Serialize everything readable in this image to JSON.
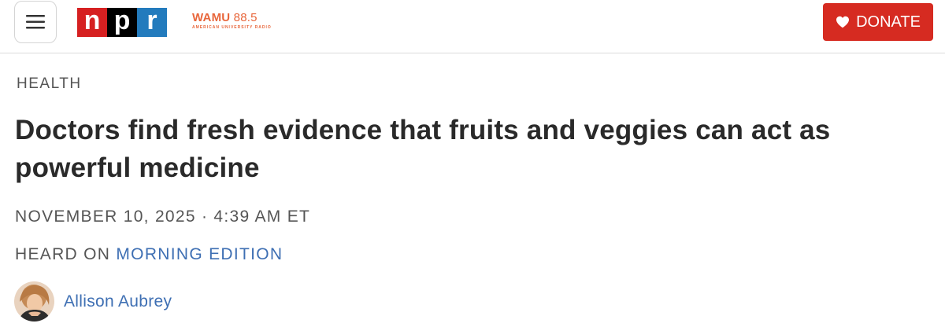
{
  "header": {
    "menu_icon": "hamburger-menu-icon",
    "logo": {
      "letters": [
        "n",
        "p",
        "r"
      ],
      "colors": [
        "#d62021",
        "#000000",
        "#237bbd"
      ]
    },
    "station": {
      "name": "WAMU",
      "frequency": "88.5",
      "tagline": "AMERICAN UNIVERSITY RADIO",
      "color": "#e8663b"
    },
    "donate": {
      "label": "DONATE",
      "icon": "heart-icon",
      "color": "#d62b21"
    }
  },
  "article": {
    "section": "HEALTH",
    "headline": "Doctors find fresh evidence that fruits and veggies can act as powerful medicine",
    "dateline": "NOVEMBER 10, 2025 · 4:39 AM ET",
    "heard_on_prefix": "HEARD ON",
    "heard_on_show": "MORNING EDITION",
    "author": "Allison Aubrey",
    "link_color": "#3e6fb3"
  }
}
